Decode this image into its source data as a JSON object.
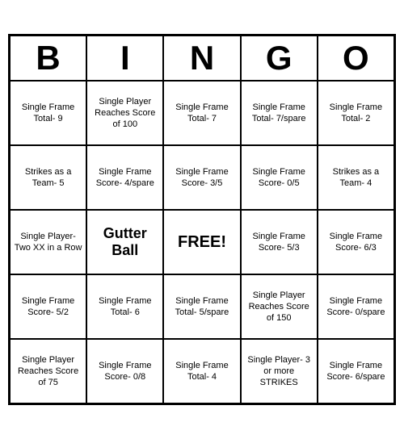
{
  "header": {
    "letters": [
      "B",
      "I",
      "N",
      "G",
      "O"
    ]
  },
  "cells": [
    {
      "text": "Single Frame Total- 9",
      "type": "normal"
    },
    {
      "text": "Single Player Reaches Score of 100",
      "type": "normal"
    },
    {
      "text": "Single Frame Total- 7",
      "type": "normal"
    },
    {
      "text": "Single Frame Total- 7/spare",
      "type": "normal"
    },
    {
      "text": "Single Frame Total- 2",
      "type": "normal"
    },
    {
      "text": "Strikes as a Team- 5",
      "type": "normal"
    },
    {
      "text": "Single Frame Score- 4/spare",
      "type": "normal"
    },
    {
      "text": "Single Frame Score- 3/5",
      "type": "normal"
    },
    {
      "text": "Single Frame Score- 0/5",
      "type": "normal"
    },
    {
      "text": "Strikes as a Team- 4",
      "type": "normal"
    },
    {
      "text": "Single Player- Two XX in a Row",
      "type": "normal"
    },
    {
      "text": "Gutter Ball",
      "type": "gutter"
    },
    {
      "text": "FREE!",
      "type": "free"
    },
    {
      "text": "Single Frame Score- 5/3",
      "type": "normal"
    },
    {
      "text": "Single Frame Score- 6/3",
      "type": "normal"
    },
    {
      "text": "Single Frame Score- 5/2",
      "type": "normal"
    },
    {
      "text": "Single Frame Total- 6",
      "type": "normal"
    },
    {
      "text": "Single Frame Total- 5/spare",
      "type": "normal"
    },
    {
      "text": "Single Player Reaches Score of 150",
      "type": "normal"
    },
    {
      "text": "Single Frame Score- 0/spare",
      "type": "normal"
    },
    {
      "text": "Single Player Reaches Score of 75",
      "type": "normal"
    },
    {
      "text": "Single Frame Score- 0/8",
      "type": "normal"
    },
    {
      "text": "Single Frame Total- 4",
      "type": "normal"
    },
    {
      "text": "Single Player- 3 or more STRIKES",
      "type": "normal"
    },
    {
      "text": "Single Frame Score- 6/spare",
      "type": "normal"
    }
  ]
}
